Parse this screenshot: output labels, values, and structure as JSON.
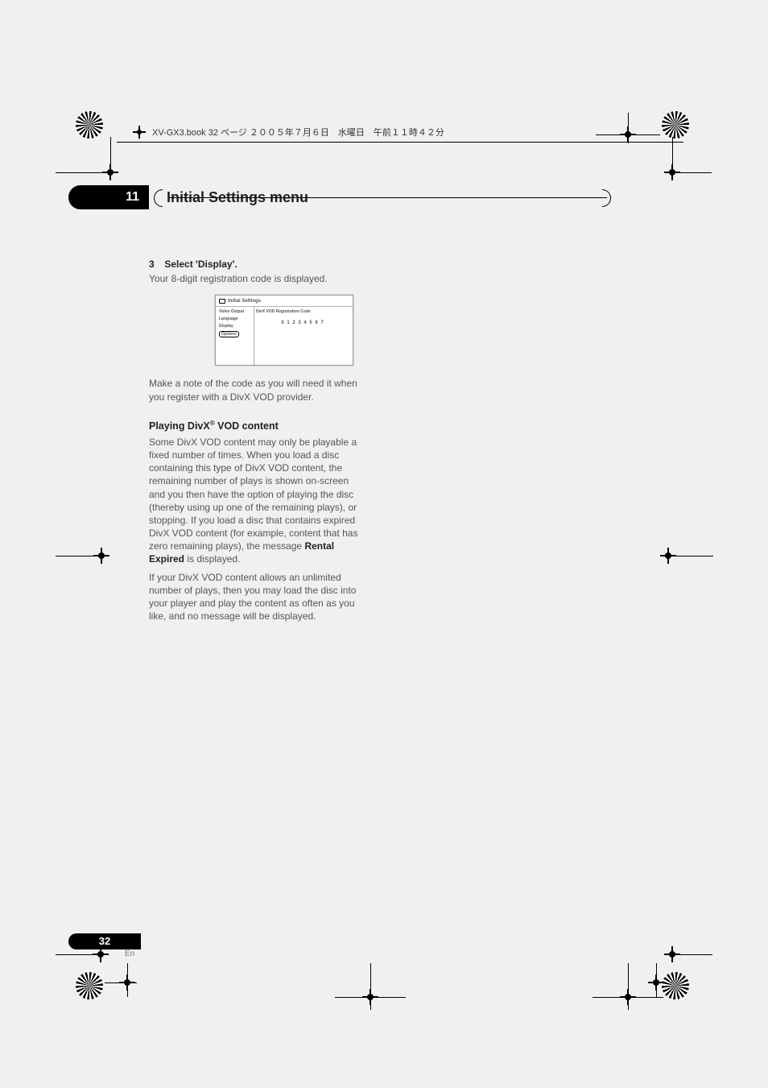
{
  "header_run": "XV-GX3.book  32 ページ  ２００５年７月６日　水曜日　午前１１時４２分",
  "chapter": {
    "num": "11",
    "title": "Initial Settings menu"
  },
  "step3": {
    "num": "3",
    "label": "Select 'Display'."
  },
  "desc1": "Your 8-digit registration code is displayed.",
  "osd": {
    "head": "Initial Settings",
    "side": {
      "video": "Video Output",
      "language": "Language",
      "display": "Display",
      "options": "Options"
    },
    "main_label": "DivX VOD Registration Code",
    "code": "0 1 2 3 4 5 6 7"
  },
  "para_note": "Make a note of the code as you will need it when you register with a DivX VOD provider.",
  "h3": {
    "pre": "Playing DivX",
    "sup": "®",
    "post": " VOD content"
  },
  "para_long_a": "Some DivX VOD content may only be playable a fixed number of times. When you load a disc containing this type of DivX VOD content, the remaining number of plays is shown on-screen and you then have the option of playing the disc (thereby using up one of the remaining plays), or stopping. If you load a disc that contains expired DivX VOD content (for example, content that has zero remaining plays), the message ",
  "para_long_bold": "Rental Expired",
  "para_long_b": " is displayed.",
  "para_unlim": "If your DivX VOD content allows an unlimited number of plays, then you may load the disc into your player and play the content as often as you like, and no message will be displayed.",
  "page": {
    "num": "32",
    "lang": "En"
  }
}
